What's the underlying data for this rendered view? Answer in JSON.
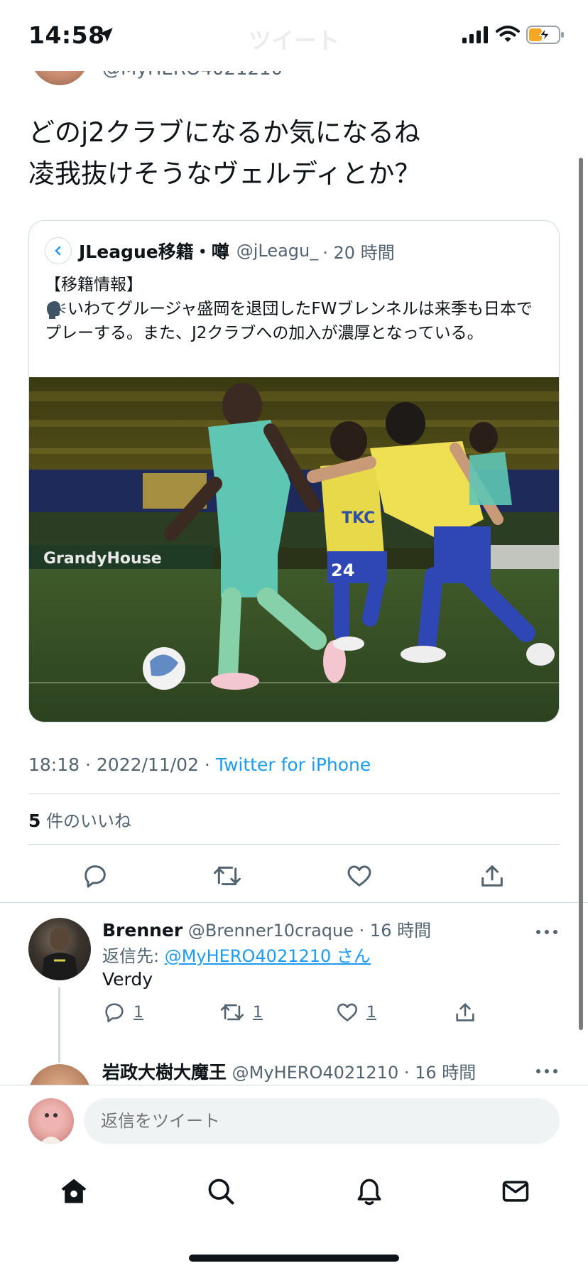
{
  "status_bar": {
    "time": "14:58",
    "title": "ツイート"
  },
  "tweet": {
    "author_handle": "@MyHERO4021210",
    "text_lines": [
      "どのj2クラブになるか気になるね",
      "凌我抜けそうなヴェルディとか？"
    ],
    "quote": {
      "name": "JLeague移籍・噂",
      "handle": "@jLeagu_",
      "time": "· 20 時間",
      "text_line1": "【移籍情報】",
      "text_line2": "いわてグルージャ盛岡を退団したFWブレンネルは来季も日本でプレーする。また、J2クラブへの加入が濃厚となっている。"
    },
    "meta": {
      "time_date": "18:18 · 2022/11/02 · ",
      "source": "Twitter for iPhone"
    },
    "likes_count": "5",
    "likes_label": " 件のいいね"
  },
  "replies": [
    {
      "name": "Brenner",
      "handle": "@Brenner10craque",
      "time": "· 16 時間",
      "replying_prefix": "返信先: ",
      "replying_to": "@MyHERO4021210 さん",
      "body": "Verdy",
      "reply_count": "1",
      "retweet_count": "1",
      "like_count": "1"
    },
    {
      "name": "岩政大樹大魔王",
      "handle": "@MyHERO4021210",
      "time": "· 16 時間"
    }
  ],
  "composer": {
    "placeholder": "返信をツイート"
  },
  "photo": {
    "banner_text": "GrandyHouse",
    "jersey_number": "24",
    "sponsor": "TKC"
  },
  "colors": {
    "accent": "#1d9bf0",
    "text_primary": "#0f1419",
    "text_secondary": "#536471",
    "border": "#cfd9de"
  },
  "icons": {
    "status": [
      "location-arrow-icon",
      "signal-icon",
      "wifi-icon",
      "battery-charging-icon"
    ],
    "actions": [
      "reply-icon",
      "retweet-icon",
      "like-icon",
      "share-icon"
    ],
    "tabs": [
      "home-icon",
      "search-icon",
      "bell-icon",
      "mail-icon"
    ]
  }
}
